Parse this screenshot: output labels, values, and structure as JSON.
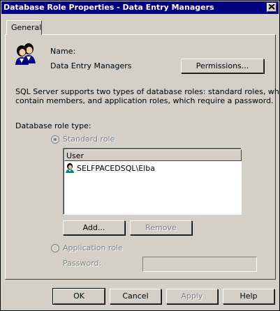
{
  "window": {
    "title": "Database Role Properties - Data Entry Managers"
  },
  "tabs": [
    {
      "label": "General"
    }
  ],
  "general": {
    "name_label": "Name:",
    "name_value": "Data Entry Managers",
    "permissions_button": "Permissions...",
    "description": [
      "SQL Server supports two types of database roles: standard roles, which",
      "contain members, and application roles, which require a password."
    ],
    "role_type_label": "Database role type:",
    "standard_role_label": "Standard role",
    "members": {
      "column_header": "User",
      "rows": [
        {
          "name": "SELFPACEDSQL\\Elba"
        }
      ]
    },
    "add_button": "Add...",
    "remove_button": "Remove",
    "application_role_label": "Application role",
    "password_label": "Password:",
    "password_value": ""
  },
  "footer": {
    "ok": "OK",
    "cancel": "Cancel",
    "apply": "Apply",
    "help": "Help"
  },
  "icons": {
    "role": "users-group-icon",
    "member": "user-icon",
    "close": "close-icon"
  },
  "colors": {
    "titlebar": "#000080",
    "face": "#d4d0c8",
    "disabled_text": "#808080"
  }
}
